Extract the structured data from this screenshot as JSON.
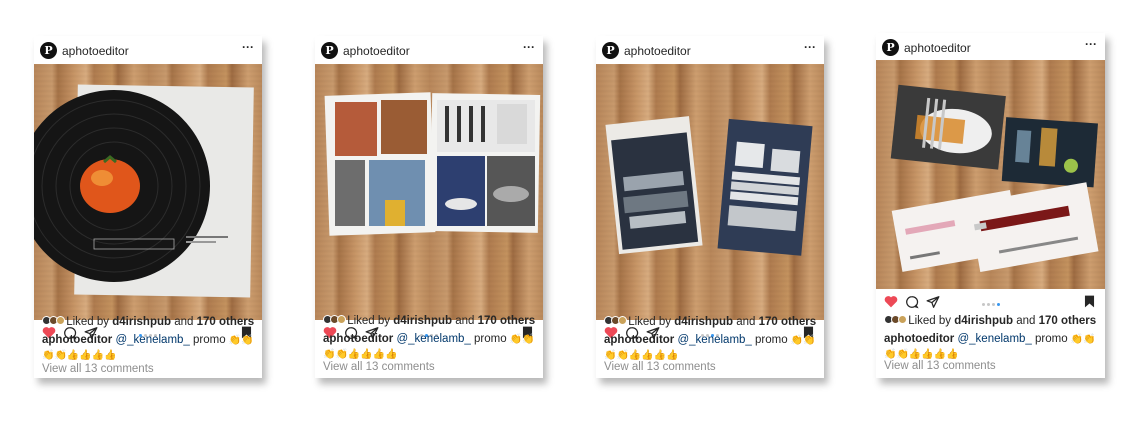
{
  "colors": {
    "heart": "#ed4956",
    "mention": "#00376b",
    "muted": "#8e8e8e",
    "dot_active": "#3897f0"
  },
  "posts": [
    {
      "username": "aphotoeditor",
      "liked_prefix": "Liked by",
      "liked_user": "d4irishpub",
      "liked_and": "and",
      "liked_count": "170 others",
      "caption_user": "aphotoeditor",
      "caption_mention": "@_kenelamb_",
      "caption_text": "promo",
      "caption_emoji": "👏👏👏👏👍👍👍👍",
      "view_comments": "View all 13 comments",
      "photo_subject": "vinyl record portfolio with tomato",
      "carousel_active": 1
    },
    {
      "username": "aphotoeditor",
      "liked_prefix": "Liked by",
      "liked_user": "d4irishpub",
      "liked_and": "and",
      "liked_count": "170 others",
      "caption_user": "aphotoeditor",
      "caption_mention": "@_kenelamb_",
      "caption_text": "promo",
      "caption_emoji": "👏👏👏👏👍👍👍👍",
      "view_comments": "View all 13 comments",
      "photo_subject": "open brochure spread",
      "carousel_active": 2
    },
    {
      "username": "aphotoeditor",
      "liked_prefix": "Liked by",
      "liked_user": "d4irishpub",
      "liked_and": "and",
      "liked_count": "170 others",
      "caption_user": "aphotoeditor",
      "caption_mention": "@_kenelamb_",
      "caption_text": "promo",
      "caption_emoji": "👏👏👏👏👍👍👍👍",
      "view_comments": "View all 13 comments",
      "photo_subject": "two cards with cookware and dishes",
      "carousel_active": 3
    },
    {
      "username": "aphotoeditor",
      "liked_prefix": "Liked by",
      "liked_user": "d4irishpub",
      "liked_and": "and",
      "liked_count": "170 others",
      "caption_user": "aphotoeditor",
      "caption_mention": "@_kenelamb_",
      "caption_text": "promo",
      "caption_emoji": "👏👏👏👏👍👍👍👍",
      "view_comments": "View all 13 comments",
      "photo_subject": "cutlery, cocktails and knife postcards",
      "carousel_active": 4
    }
  ],
  "icons": {
    "avatar": "pe-logo-icon",
    "more": "more-icon",
    "like": "heart-icon",
    "comment": "comment-icon",
    "share": "share-icon",
    "save": "bookmark-icon"
  }
}
